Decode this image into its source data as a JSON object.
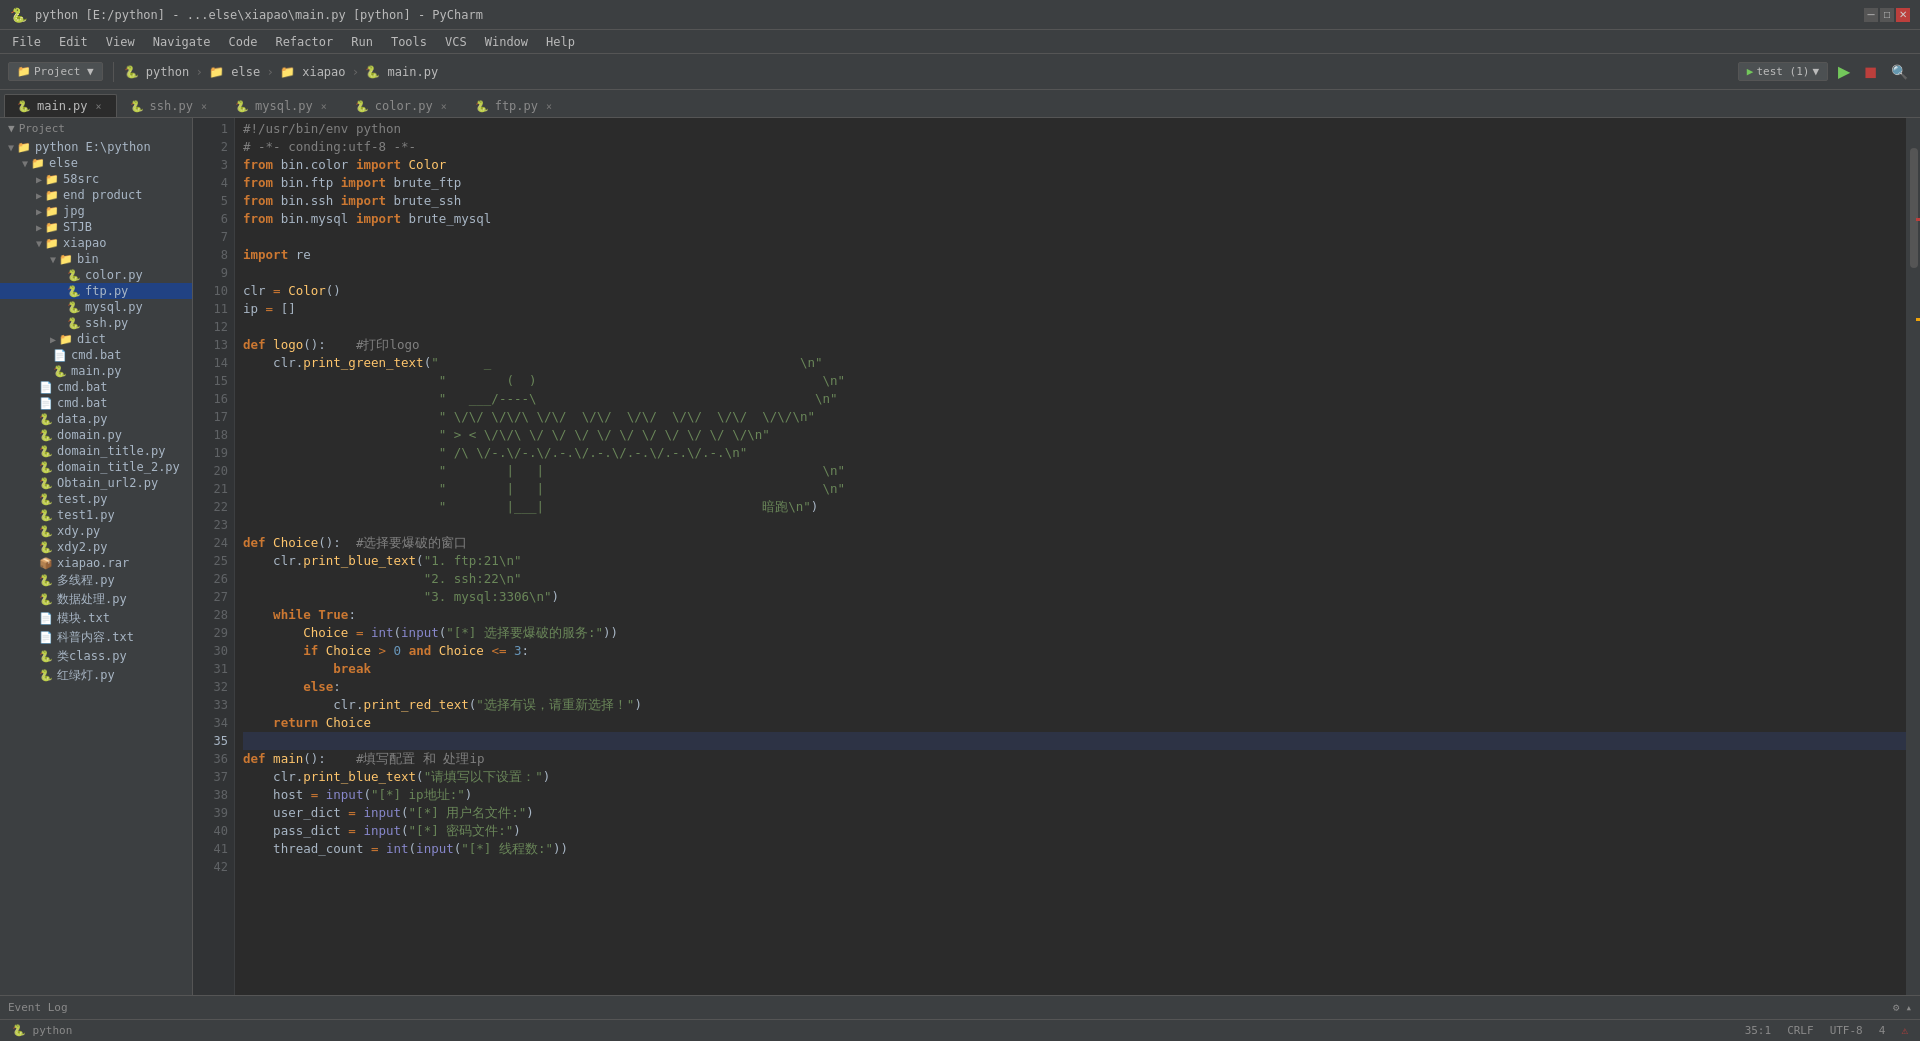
{
  "titlebar": {
    "text": "python [E:/python] - ...else\\xiapao\\main.py [python] - PyCharm",
    "min_label": "─",
    "max_label": "□",
    "close_label": "✕"
  },
  "menubar": {
    "items": [
      "File",
      "Edit",
      "View",
      "Navigate",
      "Code",
      "Refactor",
      "Run",
      "Tools",
      "VCS",
      "Window",
      "Help"
    ]
  },
  "toolbar": {
    "project_label": "Project",
    "breadcrumbs": [
      "python",
      "else",
      "xiapao",
      "main.py"
    ],
    "run_config": "test (1)",
    "run_label": "▶",
    "stop_label": "◼",
    "search_label": "🔍"
  },
  "tabs": [
    {
      "id": "main.py",
      "label": "main.py",
      "icon": "🐍",
      "active": true
    },
    {
      "id": "ssh.py",
      "label": "ssh.py",
      "icon": "🐍",
      "active": false
    },
    {
      "id": "mysql.py",
      "label": "mysql.py",
      "icon": "🐍",
      "active": false
    },
    {
      "id": "color.py",
      "label": "color.py",
      "icon": "🐍",
      "active": false
    },
    {
      "id": "ftp.py",
      "label": "ftp.py",
      "icon": "🐍",
      "active": false
    }
  ],
  "sidebar": {
    "header": "Project ▼",
    "python_label": "python E:\\python",
    "items": [
      {
        "label": "python E:\\python",
        "indent": 0,
        "arrow": "▼",
        "icon": "📁",
        "type": "root"
      },
      {
        "label": "else",
        "indent": 1,
        "arrow": "▼",
        "icon": "📁",
        "type": "folder"
      },
      {
        "label": "58src",
        "indent": 2,
        "arrow": "▶",
        "icon": "📁",
        "type": "folder"
      },
      {
        "label": "end product",
        "indent": 2,
        "arrow": "▶",
        "icon": "📁",
        "type": "folder"
      },
      {
        "label": "jpg",
        "indent": 2,
        "arrow": "▶",
        "icon": "📁",
        "type": "folder"
      },
      {
        "label": "STJB",
        "indent": 2,
        "arrow": "▶",
        "icon": "📁",
        "type": "folder"
      },
      {
        "label": "xiapao",
        "indent": 2,
        "arrow": "▼",
        "icon": "📁",
        "type": "folder"
      },
      {
        "label": "bin",
        "indent": 3,
        "arrow": "▼",
        "icon": "📁",
        "type": "folder"
      },
      {
        "label": "color.py",
        "indent": 4,
        "arrow": "",
        "icon": "🐍",
        "type": "file"
      },
      {
        "label": "ftp.py",
        "indent": 4,
        "arrow": "",
        "icon": "🐍",
        "type": "file",
        "selected": true
      },
      {
        "label": "mysql.py",
        "indent": 4,
        "arrow": "",
        "icon": "🐍",
        "type": "file"
      },
      {
        "label": "ssh.py",
        "indent": 4,
        "arrow": "",
        "icon": "🐍",
        "type": "file"
      },
      {
        "label": "dict",
        "indent": 3,
        "arrow": "▶",
        "icon": "📁",
        "type": "folder"
      },
      {
        "label": "cmd.bat",
        "indent": 3,
        "arrow": "",
        "icon": "📄",
        "type": "file"
      },
      {
        "label": "main.py",
        "indent": 3,
        "arrow": "",
        "icon": "🐍",
        "type": "file"
      },
      {
        "label": "cmd.bat",
        "indent": 2,
        "arrow": "",
        "icon": "📄",
        "type": "file"
      },
      {
        "label": "cmd.bat",
        "indent": 2,
        "arrow": "",
        "icon": "📄",
        "type": "file"
      },
      {
        "label": "data.py",
        "indent": 2,
        "arrow": "",
        "icon": "🐍",
        "type": "file"
      },
      {
        "label": "domain.py",
        "indent": 2,
        "arrow": "",
        "icon": "🐍",
        "type": "file"
      },
      {
        "label": "domain_title.py",
        "indent": 2,
        "arrow": "",
        "icon": "🐍",
        "type": "file"
      },
      {
        "label": "domain_title_2.py",
        "indent": 2,
        "arrow": "",
        "icon": "🐍",
        "type": "file"
      },
      {
        "label": "Obtain_url2.py",
        "indent": 2,
        "arrow": "",
        "icon": "🐍",
        "type": "file"
      },
      {
        "label": "test.py",
        "indent": 2,
        "arrow": "",
        "icon": "🐍",
        "type": "file"
      },
      {
        "label": "test1.py",
        "indent": 2,
        "arrow": "",
        "icon": "🐍",
        "type": "file"
      },
      {
        "label": "xdy.py",
        "indent": 2,
        "arrow": "",
        "icon": "🐍",
        "type": "file"
      },
      {
        "label": "xdy2.py",
        "indent": 2,
        "arrow": "",
        "icon": "🐍",
        "type": "file"
      },
      {
        "label": "xiapao.rar",
        "indent": 2,
        "arrow": "",
        "icon": "📦",
        "type": "file"
      },
      {
        "label": "多线程.py",
        "indent": 2,
        "arrow": "",
        "icon": "🐍",
        "type": "file"
      },
      {
        "label": "数据处理.py",
        "indent": 2,
        "arrow": "",
        "icon": "🐍",
        "type": "file"
      },
      {
        "label": "模块.txt",
        "indent": 2,
        "arrow": "",
        "icon": "📄",
        "type": "file"
      },
      {
        "label": "科普内容.txt",
        "indent": 2,
        "arrow": "",
        "icon": "📄",
        "type": "file"
      },
      {
        "label": "类class.py",
        "indent": 2,
        "arrow": "",
        "icon": "🐍",
        "type": "file"
      },
      {
        "label": "红绿灯.py",
        "indent": 2,
        "arrow": "",
        "icon": "🐍",
        "type": "file"
      }
    ]
  },
  "editor": {
    "filename": "main.py",
    "lines": [
      {
        "num": 1,
        "content": "#!/usr/bin/env python"
      },
      {
        "num": 2,
        "content": "# -*- conding:utf-8 -*-"
      },
      {
        "num": 3,
        "content": "from bin.color import Color"
      },
      {
        "num": 4,
        "content": "from bin.ftp import brute_ftp"
      },
      {
        "num": 5,
        "content": "from bin.ssh import brute_ssh"
      },
      {
        "num": 6,
        "content": "from bin.mysql import brute_mysql"
      },
      {
        "num": 7,
        "content": ""
      },
      {
        "num": 8,
        "content": "import re"
      },
      {
        "num": 9,
        "content": ""
      },
      {
        "num": 10,
        "content": "clr = Color()"
      },
      {
        "num": 11,
        "content": "ip = []"
      },
      {
        "num": 12,
        "content": ""
      },
      {
        "num": 13,
        "content": "def logo():    #打印logo"
      },
      {
        "num": 14,
        "content": "    clr.print_green_text(\"      _                                         \\n\""
      },
      {
        "num": 15,
        "content": "                          \"        (  )                                      \\n\""
      },
      {
        "num": 16,
        "content": "                          \"   ___/----\\                                     \\n\""
      },
      {
        "num": 17,
        "content": "                          \" \\/\\/ \\/\\/\\ \\/\\/  \\/\\/  \\/\\/  \\/\\/  \\/\\/  \\/\\/\\n\""
      },
      {
        "num": 18,
        "content": "                          \" > < \\/\\/\\ \\/ \\/ \\/ \\/ \\/ \\/ \\/ \\/ \\/ \\/\\n\""
      },
      {
        "num": 19,
        "content": "                          \" /\\ \\/-.\\/-.\\/.-.\\/.-.\\/.-.\\/.-.\\/.-.\\n\""
      },
      {
        "num": 20,
        "content": "                          \"        |   |                                     \\n\""
      },
      {
        "num": 21,
        "content": "                          \"        |   |                                     \\n\""
      },
      {
        "num": 22,
        "content": "                          \"        |___|                             暗跑\\n\")"
      },
      {
        "num": 23,
        "content": ""
      },
      {
        "num": 24,
        "content": "def Choice():  #选择要爆破的窗口"
      },
      {
        "num": 25,
        "content": "    clr.print_blue_text(\"1. ftp:21\\n\""
      },
      {
        "num": 26,
        "content": "                        \"2. ssh:22\\n\""
      },
      {
        "num": 27,
        "content": "                        \"3. mysql:3306\\n\")"
      },
      {
        "num": 28,
        "content": "    while True:"
      },
      {
        "num": 29,
        "content": "        Choice = int(input(\"[*] 选择要爆破的服务:\"))"
      },
      {
        "num": 30,
        "content": "        if Choice > 0 and Choice <= 3:"
      },
      {
        "num": 31,
        "content": "            break"
      },
      {
        "num": 32,
        "content": "        else:"
      },
      {
        "num": 33,
        "content": "            clr.print_red_text(\"选择有误，请重新选择！\")"
      },
      {
        "num": 34,
        "content": "    return Choice"
      },
      {
        "num": 35,
        "content": ""
      },
      {
        "num": 36,
        "content": "def main():    #填写配置 和 处理ip"
      },
      {
        "num": 37,
        "content": "    clr.print_blue_text(\"请填写以下设置：\")"
      },
      {
        "num": 38,
        "content": "    host = input(\"[*] ip地址:\")"
      },
      {
        "num": 39,
        "content": "    user_dict = input(\"[*] 用户名文件:\")"
      },
      {
        "num": 40,
        "content": "    pass_dict = input(\"[*] 密码文件:\")"
      },
      {
        "num": 41,
        "content": "    thread_count = int(input(\"[*] 线程数:\"))"
      },
      {
        "num": 42,
        "content": ""
      }
    ]
  },
  "statusbar": {
    "position": "35:1",
    "line_ending": "CRLF",
    "encoding": "UTF-8",
    "indent": "4"
  },
  "bottom": {
    "event_log_label": "Event Log",
    "settings_icon": "⚙"
  }
}
